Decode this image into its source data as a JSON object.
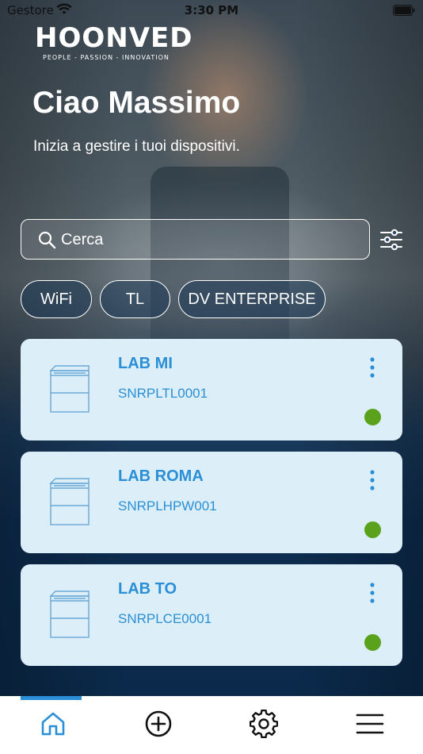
{
  "status_bar": {
    "carrier": "Gestore",
    "time": "3:30 PM"
  },
  "brand": {
    "name": "HOONVED",
    "tagline": "PEOPLE - PASSION - INNOVATION"
  },
  "greeting": {
    "title": "Ciao Massimo",
    "subtitle": "Inizia a gestire i tuoi dispositivi."
  },
  "search": {
    "placeholder": "Cerca",
    "value": ""
  },
  "filters": [
    {
      "label": "WiFi"
    },
    {
      "label": "TL"
    },
    {
      "label": "DV ENTERPRISE"
    }
  ],
  "devices": [
    {
      "name": "LAB MI",
      "serial": "SNRPLTL0001",
      "status": "online"
    },
    {
      "name": "LAB ROMA",
      "serial": "SNRPLHPW001",
      "status": "online"
    },
    {
      "name": "LAB TO",
      "serial": "SNRPLCE0001",
      "status": "online"
    }
  ],
  "tabbar": {
    "items": [
      {
        "icon": "home-icon",
        "active": true
      },
      {
        "icon": "add-circle-icon",
        "active": false
      },
      {
        "icon": "gear-icon",
        "active": false
      },
      {
        "icon": "menu-icon",
        "active": false
      }
    ]
  },
  "colors": {
    "accent": "#2a8fd6",
    "card_bg": "#dceef8",
    "status_online": "#5aa21b",
    "background_dark": "#0d2b4a"
  }
}
